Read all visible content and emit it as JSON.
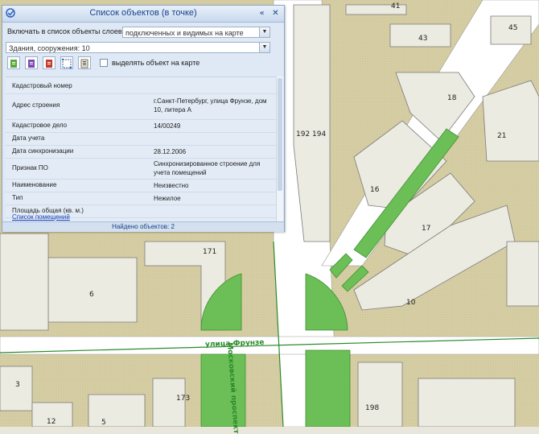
{
  "panel": {
    "title": "Список объектов (в точке)",
    "layers_label": "Включать в список объекты слоев:",
    "layers_value": "подключенных и видимых на карте",
    "object_value": "Здания, сооружения: 10",
    "highlight_label": "выделять объект на карте",
    "properties": [
      {
        "key": "Кадастровый номер",
        "value": ""
      },
      {
        "key": "Адрес строения",
        "value": "г.Санкт-Петербург, улица Фрунзе, дом 10, литера А"
      },
      {
        "key": "Кадастровое дело",
        "value": "14/00249"
      },
      {
        "key": "Дата учета",
        "value": ""
      },
      {
        "key": "Дата синхронизации",
        "value": "28.12.2006"
      },
      {
        "key": "Признак ПО",
        "value": "Синхронизированное строение для учета помещений"
      },
      {
        "key": "Наименование",
        "value": "Неизвестно"
      },
      {
        "key": "Тип",
        "value": "Нежилое"
      },
      {
        "key": "Площадь общая (кв. м.)",
        "value": ""
      }
    ],
    "rooms_link": "Список помещений",
    "status": "Найдено объектов: 2"
  },
  "map": {
    "building_numbers": [
      "41",
      "43",
      "45",
      "18",
      "192",
      "194",
      "21",
      "16",
      "17",
      "10",
      "171",
      "6",
      "173",
      "3",
      "12",
      "5",
      "198"
    ],
    "streets": [
      "улица Фрунзе",
      "Московский проспект"
    ],
    "colors": {
      "park": "#6cbf57",
      "building": "#ecebe2",
      "block": "#d8d0a8",
      "road": "#ffffff",
      "street_label": "#2a8a2a"
    }
  },
  "icons": [
    "app-logo-icon",
    "collapse-icon",
    "close-icon",
    "doc-green-icon",
    "doc-purple-icon",
    "doc-red-icon",
    "grid-icon",
    "list-icon"
  ]
}
